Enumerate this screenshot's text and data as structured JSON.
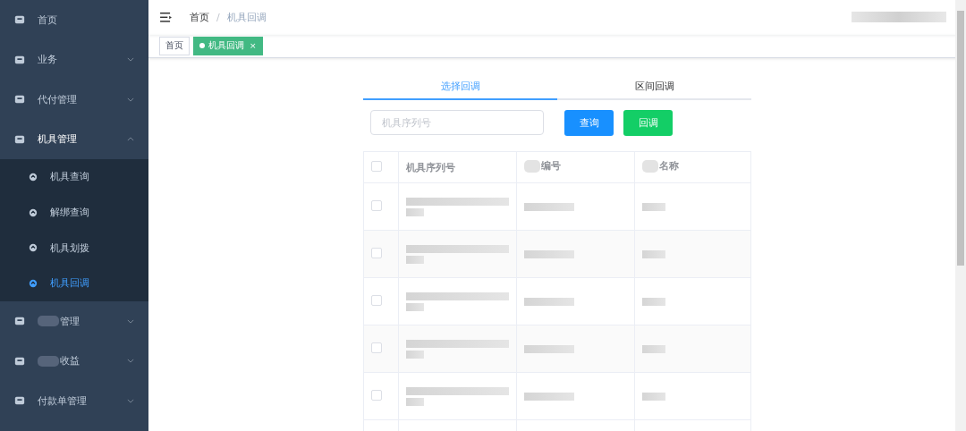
{
  "sidebar": {
    "items": [
      {
        "label": "首页",
        "expandable": false,
        "expanded": false,
        "obscured": false
      },
      {
        "label": "业务",
        "expandable": true,
        "expanded": false,
        "obscured": false
      },
      {
        "label": "代付管理",
        "expandable": true,
        "expanded": false,
        "obscured": false
      },
      {
        "label": "机具管理",
        "expandable": true,
        "expanded": true,
        "obscured": false,
        "children": [
          {
            "label": "机具查询",
            "selected": false
          },
          {
            "label": "解绑查询",
            "selected": false
          },
          {
            "label": "机具划拨",
            "selected": false
          },
          {
            "label": "机具回调",
            "selected": true
          }
        ]
      },
      {
        "label": "管理",
        "expandable": true,
        "expanded": false,
        "obscured": true
      },
      {
        "label": "收益",
        "expandable": true,
        "expanded": false,
        "obscured": true
      },
      {
        "label": "付款单管理",
        "expandable": true,
        "expanded": false,
        "obscured": false
      }
    ]
  },
  "breadcrumb": {
    "separator": "/",
    "items": [
      "首页",
      "机具回调"
    ]
  },
  "tags": [
    {
      "label": "首页",
      "selected": false,
      "closable": false
    },
    {
      "label": "机具回调",
      "selected": true,
      "closable": true,
      "close": "×"
    }
  ],
  "tabs": [
    {
      "label": "选择回调",
      "selected": true
    },
    {
      "label": "区间回调",
      "selected": false
    }
  ],
  "search": {
    "placeholder": "机具序列号"
  },
  "buttons": [
    {
      "label": "查询",
      "kind": "primary"
    },
    {
      "label": "回调",
      "kind": "success"
    }
  ],
  "table": {
    "columns": [
      {
        "label": "机具序列号",
        "obscured": false
      },
      {
        "label": "编号",
        "obscured": true
      },
      {
        "label": "名称",
        "obscured": true
      }
    ],
    "rows": [
      {
        "checked": false
      },
      {
        "checked": false
      },
      {
        "checked": false
      },
      {
        "checked": false
      },
      {
        "checked": false
      }
    ],
    "header_checked": false
  }
}
